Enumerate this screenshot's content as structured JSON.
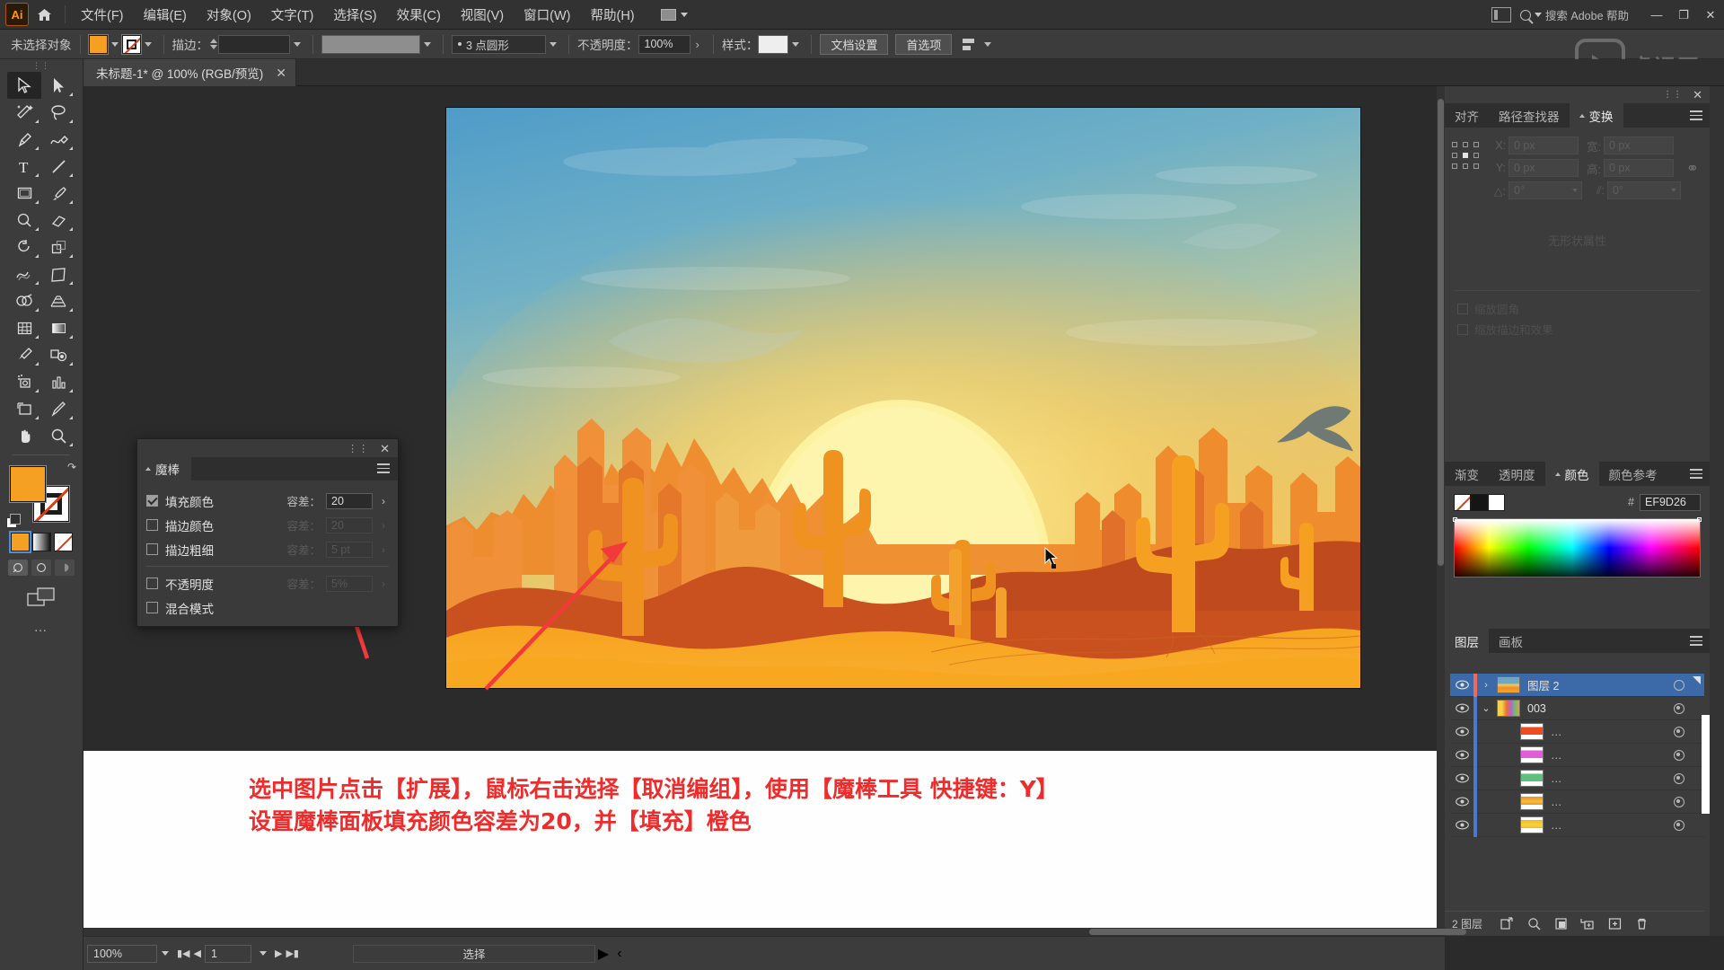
{
  "app": {
    "logo_text": "Ai",
    "menus": [
      "文件(F)",
      "编辑(E)",
      "对象(O)",
      "文字(T)",
      "选择(S)",
      "效果(C)",
      "视图(V)",
      "窗口(W)",
      "帮助(H)"
    ],
    "search_placeholder": "搜索 Adobe 帮助",
    "watermark": "虎课网"
  },
  "control_bar": {
    "selection_status": "未选择对象",
    "fill_color": "#F5A023",
    "stroke_label": "描边：",
    "stroke_weight": "",
    "profile_label": "3 点圆形",
    "opacity_label": "不透明度：",
    "opacity_value": "100%",
    "style_label": "样式：",
    "document_setup": "文档设置",
    "preferences": "首选项"
  },
  "document": {
    "tab_title": "未标题-1* @ 100% (RGB/预览)"
  },
  "toolbar": {
    "tools": [
      {
        "name": "selection-tool",
        "active": true
      },
      {
        "name": "direct-selection-tool",
        "active": false
      },
      {
        "name": "magic-wand-tool",
        "active": false
      },
      {
        "name": "lasso-tool",
        "active": false
      },
      {
        "name": "pen-tool",
        "active": false
      },
      {
        "name": "curvature-tool",
        "active": false
      },
      {
        "name": "type-tool",
        "active": false
      },
      {
        "name": "line-segment-tool",
        "active": false
      },
      {
        "name": "rectangle-tool",
        "active": false
      },
      {
        "name": "paintbrush-tool",
        "active": false
      },
      {
        "name": "shaper-tool",
        "active": false
      },
      {
        "name": "eraser-tool",
        "active": false
      },
      {
        "name": "rotate-tool",
        "active": false
      },
      {
        "name": "scale-tool",
        "active": false
      },
      {
        "name": "width-tool",
        "active": false
      },
      {
        "name": "free-transform-tool",
        "active": false
      },
      {
        "name": "shape-builder-tool",
        "active": false
      },
      {
        "name": "perspective-grid-tool",
        "active": false
      },
      {
        "name": "mesh-tool",
        "active": false
      },
      {
        "name": "gradient-tool",
        "active": false
      },
      {
        "name": "eyedropper-tool",
        "active": false
      },
      {
        "name": "blend-tool",
        "active": false
      },
      {
        "name": "symbol-sprayer-tool",
        "active": false
      },
      {
        "name": "column-graph-tool",
        "active": false
      },
      {
        "name": "artboard-tool",
        "active": false
      },
      {
        "name": "slice-tool",
        "active": false
      },
      {
        "name": "hand-tool",
        "active": false
      },
      {
        "name": "zoom-tool",
        "active": false
      }
    ],
    "fill_color": "#F5A023",
    "stroke_color": "#FFFFFF",
    "more_label": "…"
  },
  "magic_wand_panel": {
    "title": "魔棒",
    "rows": [
      {
        "label": "填充颜色",
        "checked": true,
        "tolerance_label": "容差：",
        "value": "20",
        "enabled": true
      },
      {
        "label": "描边颜色",
        "checked": false,
        "tolerance_label": "容差：",
        "value": "20",
        "enabled": false
      },
      {
        "label": "描边粗细",
        "checked": false,
        "tolerance_label": "容差：",
        "value": "5 pt",
        "enabled": false
      },
      {
        "label": "不透明度",
        "checked": false,
        "tolerance_label": "容差：",
        "value": "5%",
        "enabled": false
      },
      {
        "label": "混合模式",
        "checked": false,
        "tolerance_label": "",
        "value": "",
        "enabled": false
      }
    ]
  },
  "transform_panel": {
    "tabs": [
      {
        "label": "对齐",
        "active": false
      },
      {
        "label": "路径查找器",
        "active": false
      },
      {
        "label": "变换",
        "active": true
      }
    ],
    "fields": [
      {
        "label": "X:",
        "value": "0 px"
      },
      {
        "label": "宽:",
        "value": "0 px"
      },
      {
        "label": "Y:",
        "value": "0 px"
      },
      {
        "label": "高:",
        "value": "0 px"
      }
    ],
    "angle_label": "△:",
    "angle_value": "0°",
    "shear_label": "⫽:",
    "shear_value": "0°",
    "empty_text": "无形状属性",
    "options": [
      "缩放圆角",
      "缩放描边和效果"
    ]
  },
  "color_panel": {
    "tabs": [
      {
        "label": "渐变",
        "active": false
      },
      {
        "label": "透明度",
        "active": false
      },
      {
        "label": "颜色",
        "active": true
      },
      {
        "label": "颜色参考",
        "active": false
      }
    ],
    "hash_label": "#",
    "hex_value": "EF9D26"
  },
  "layers_panel": {
    "tabs": [
      {
        "label": "图层",
        "active": true
      },
      {
        "label": "画板",
        "active": false
      }
    ],
    "rows": [
      {
        "name": "图层 2",
        "selected": true,
        "indent": 0,
        "color": "#f06a5a",
        "thumb": "sunset",
        "expander": "collapsed"
      },
      {
        "name": "003",
        "selected": false,
        "indent": 1,
        "color": "#4a78d0",
        "thumb": "strips",
        "expander": "expanded"
      },
      {
        "name": "…",
        "selected": false,
        "indent": 2,
        "color": "#4a78d0",
        "thumb": "red",
        "expander": "none"
      },
      {
        "name": "…",
        "selected": false,
        "indent": 2,
        "color": "#4a78d0",
        "thumb": "magenta",
        "expander": "none"
      },
      {
        "name": "…",
        "selected": false,
        "indent": 2,
        "color": "#4a78d0",
        "thumb": "green",
        "expander": "none"
      },
      {
        "name": "…",
        "selected": false,
        "indent": 2,
        "color": "#4a78d0",
        "thumb": "orange",
        "expander": "none"
      },
      {
        "name": "…",
        "selected": false,
        "indent": 2,
        "color": "#4a78d0",
        "thumb": "yellow",
        "expander": "none"
      }
    ],
    "count_label": "2 图层"
  },
  "annotation": {
    "line1": "选中图片点击【扩展】，鼠标右击选择【取消编组】，使用【魔棒工具 快捷键：Y】",
    "line2": "设置魔棒面板填充颜色容差为20，并【填充】橙色",
    "color": "#F02B2B"
  },
  "status_bar": {
    "zoom": "100%",
    "page": "1",
    "status_text": "选择"
  },
  "artwork": {
    "description": "desert-sunset-illustration",
    "sky_top": "#5ba3cc",
    "sun": "#fdf5a8",
    "sand": "#f7a723",
    "mesa": "#e8762a",
    "dune_dark": "#c0491f"
  }
}
